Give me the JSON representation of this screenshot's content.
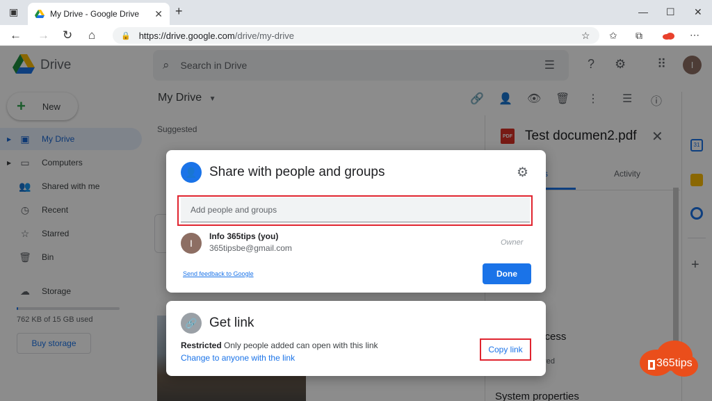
{
  "browser": {
    "tab_title": "My Drive - Google Drive",
    "tab_close": "✕",
    "new_tab": "+",
    "minimize": "—",
    "maximize": "☐",
    "close": "✕",
    "url_host": "https://drive.google.com",
    "url_path": "/drive/my-drive"
  },
  "drive": {
    "brand": "Drive",
    "search_placeholder": "Search in Drive",
    "avatar_initial": "I",
    "new_label": "New",
    "nav": [
      {
        "label": "My Drive"
      },
      {
        "label": "Computers"
      },
      {
        "label": "Shared with me"
      },
      {
        "label": "Recent"
      },
      {
        "label": "Starred"
      },
      {
        "label": "Bin"
      },
      {
        "label": "Storage"
      }
    ],
    "storage_used_fraction": 0.0,
    "storage_text": "762 KB of 15 GB used",
    "buy_storage": "Buy storage",
    "location": "My Drive",
    "suggested": "Suggested"
  },
  "details": {
    "file_badge": "PDF",
    "file_name": "Test documen2.pdf",
    "tab_details_partial": "s",
    "tab_activity": "Activity",
    "access_partial": "ccess",
    "shared_partial": "ared",
    "system_properties": "System properties"
  },
  "share_dialog": {
    "title": "Share with people and groups",
    "input_placeholder": "Add people and groups",
    "person": {
      "initial": "I",
      "name": "Info 365tips (you)",
      "email": "365tipsbe@gmail.com",
      "role": "Owner"
    },
    "feedback": "Send feedback to Google",
    "done": "Done"
  },
  "get_link_dialog": {
    "title": "Get link",
    "restricted_bold": "Restricted",
    "restricted_text": "Only people added can open with this link",
    "change_link": "Change to anyone with the link",
    "copy_link": "Copy link"
  },
  "watermark": "365tips",
  "colors": {
    "accent": "#1a73e8",
    "highlight": "#e0242f",
    "watermark": "#ea4e1b"
  }
}
